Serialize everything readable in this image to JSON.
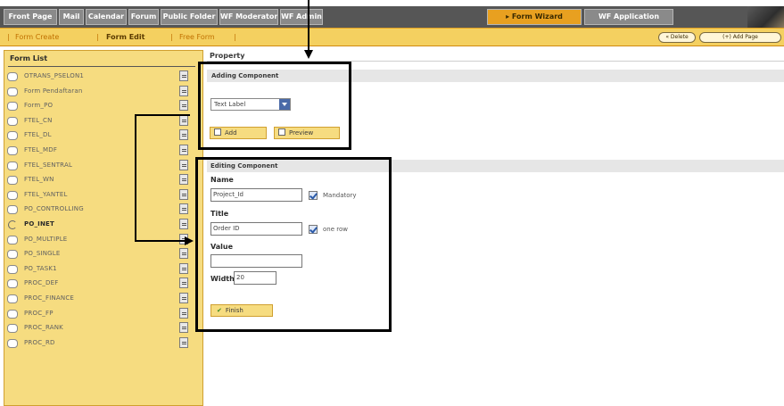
{
  "top_tabs": [
    {
      "label": "Front Page"
    },
    {
      "label": "Mail"
    },
    {
      "label": "Calendar"
    },
    {
      "label": "Forum"
    },
    {
      "label": "Public Folder"
    },
    {
      "label": "WF Moderator"
    },
    {
      "label": "WF Admin"
    },
    {
      "label": "Form Wizard",
      "active": true
    },
    {
      "label": "WF Application"
    }
  ],
  "sub_nav": {
    "items": [
      "Form Create",
      "Form Edit",
      "Free Form"
    ],
    "active": "Form Edit",
    "separator": "|",
    "delete_label": "« Delete",
    "add_page_label": "(+) Add Page"
  },
  "form_list": {
    "header": "Form List",
    "items": [
      "OTRANS_PSELON1",
      "Form Pendaftaran",
      "Form_PO",
      "FTEL_CN",
      "FTEL_DL",
      "FTEL_MDF",
      "FTEL_SENTRAL",
      "FTEL_WN",
      "FTEL_YANTEL",
      "PO_CONTROLLING",
      "PO_INET",
      "PO_MULTIPLE",
      "PO_SINGLE",
      "PO_TASK1",
      "PROC_DEF",
      "PROC_FINANCE",
      "PROC_FP",
      "PROC_RANK",
      "PROC_RD"
    ],
    "selected": "PO_INET"
  },
  "properties": {
    "tab_label": "Property",
    "adding": {
      "title": "Adding Component",
      "component_type": "Text Label",
      "add_label": "Add",
      "preview_label": "Preview"
    },
    "editing": {
      "title": "Editing Component",
      "name_label": "Name",
      "name_value": "Project_Id",
      "mandatory_label": "Mandatory",
      "mandatory_checked": true,
      "title_label": "Title",
      "title_value": "Order ID",
      "one_row_label": "one row",
      "one_row_checked": true,
      "value_label": "Value",
      "value_value": "",
      "width_label": "Width",
      "width_value": "20",
      "finish_label": "Finish"
    }
  },
  "icons": [
    "checkbox-icon",
    "edit-icon",
    "dropdown-arrow-icon",
    "add-icon",
    "preview-icon",
    "checkmark-icon",
    "logo-icon"
  ],
  "colors": {
    "tab_active": "#e8a020",
    "panel": "#f6dc80",
    "topbar": "#565656",
    "outline": "#000000"
  }
}
